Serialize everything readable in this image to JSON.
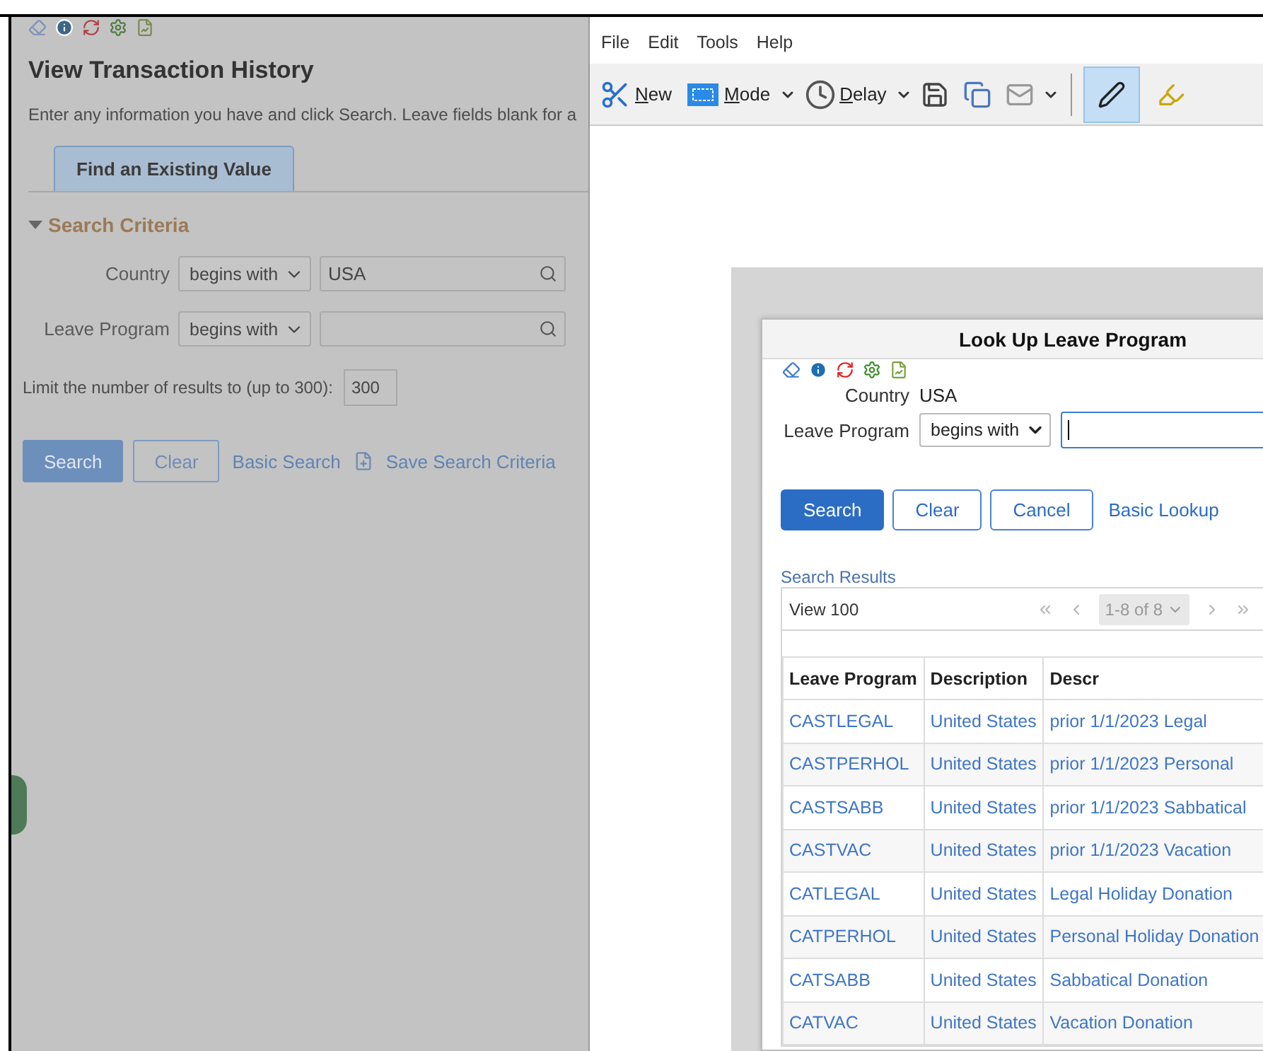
{
  "background_page": {
    "title": "View Transaction History",
    "instructions": "Enter any information you have and click Search. Leave fields blank for a",
    "tabs": [
      {
        "label": "Find an Existing Value",
        "selected": true
      }
    ],
    "section": {
      "title": "Search Criteria",
      "expanded": true
    },
    "criteria": [
      {
        "label": "Country",
        "operator": "begins with",
        "value": "USA"
      },
      {
        "label": "Leave Program",
        "operator": "begins with"
      }
    ],
    "limit": {
      "label": "Limit the number of results to (up to 300):",
      "value": "300"
    },
    "buttons": [
      {
        "label": "Search",
        "kind": "primary"
      },
      {
        "label": "Clear",
        "kind": "secondary"
      },
      {
        "label": "Basic Search",
        "kind": "link"
      },
      {
        "label": "Save Search Criteria",
        "kind": "icon_link"
      }
    ]
  },
  "snipping_tool": {
    "menu": [
      "File",
      "Edit",
      "Tools",
      "Help"
    ],
    "toolbar": [
      {
        "label": "New",
        "kind": "new"
      },
      {
        "label": "Mode",
        "kind": "mode"
      },
      {
        "label": "Delay",
        "kind": "delay"
      },
      {
        "kind": "save"
      },
      {
        "kind": "copy"
      },
      {
        "kind": "send"
      }
    ],
    "tools": [
      {
        "kind": "pen",
        "selected": true
      },
      {
        "kind": "highlighter",
        "selected": false
      }
    ]
  },
  "lookup_dialog": {
    "title": "Look Up Leave Program",
    "fields": [
      {
        "kind": "static",
        "label": "Country",
        "value": "USA"
      },
      {
        "kind": "input",
        "label": "Leave Program",
        "operator": "begins with"
      }
    ],
    "buttons": [
      {
        "label": "Search",
        "kind": "primary"
      },
      {
        "label": "Clear",
        "kind": "secondary"
      },
      {
        "label": "Cancel",
        "kind": "secondary"
      },
      {
        "label": "Basic Lookup",
        "kind": "link"
      }
    ],
    "results_title": "Search Results",
    "view": "View 100",
    "pager": "1-8 of 8",
    "columns": [
      "Leave Program",
      "Description",
      "Descr"
    ],
    "rows": [
      [
        "CASTLEGAL",
        "United States",
        "prior 1/1/2023 Legal"
      ],
      [
        "CASTPERHOL",
        "United States",
        "prior 1/1/2023 Personal"
      ],
      [
        "CASTSABB",
        "United States",
        "prior 1/1/2023 Sabbatical"
      ],
      [
        "CASTVAC",
        "United States",
        "prior 1/1/2023 Vacation"
      ],
      [
        "CATLEGAL",
        "United States",
        "Legal Holiday Donation"
      ],
      [
        "CATPERHOL",
        "United States",
        "Personal Holiday Donation"
      ],
      [
        "CATSABB",
        "United States",
        "Sabbatical Donation"
      ],
      [
        "CATVAC",
        "United States",
        "Vacation Donation"
      ]
    ]
  }
}
